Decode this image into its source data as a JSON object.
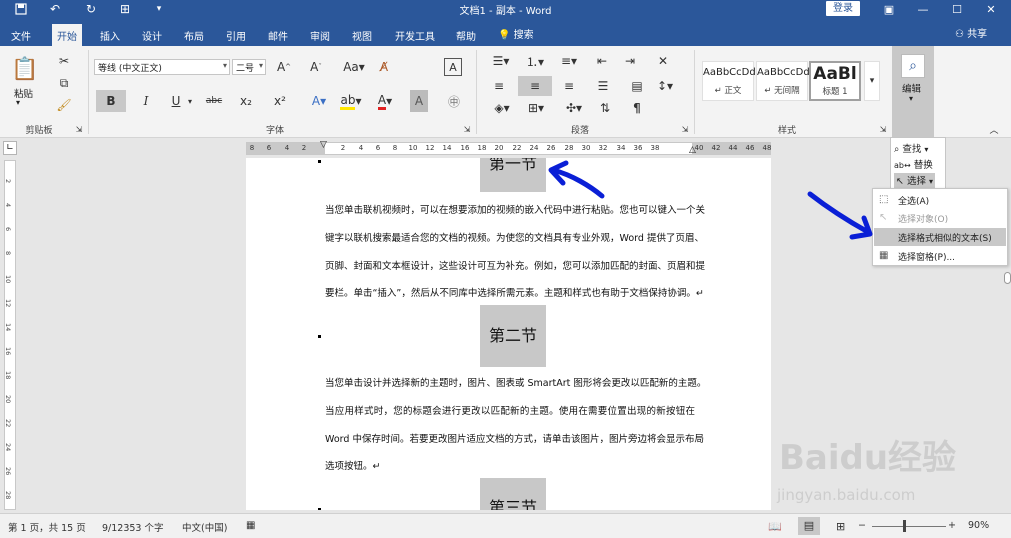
{
  "window": {
    "title": "文档1 - 副本  -  Word",
    "login_label": "登录"
  },
  "tabs": [
    "文件",
    "开始",
    "插入",
    "设计",
    "布局",
    "引用",
    "邮件",
    "审阅",
    "视图",
    "开发工具",
    "帮助"
  ],
  "active_tab": "开始",
  "tell_me": "搜索",
  "share": "共享",
  "ribbon": {
    "clipboard": {
      "paste_label": "粘贴",
      "group_label": "剪贴板"
    },
    "font": {
      "font_name": "等线 (中文正文)",
      "font_size": "二号",
      "group_label": "字体",
      "bold": "B",
      "italic": "I",
      "underline": "U",
      "strike": "abc",
      "subscript": "x₂",
      "superscript": "x²"
    },
    "paragraph": {
      "group_label": "段落"
    },
    "styles": {
      "group_label": "样式",
      "items": [
        {
          "preview": "AaBbCcDd",
          "name": "↵ 正文"
        },
        {
          "preview": "AaBbCcDd",
          "name": "↵ 无间隔"
        },
        {
          "preview": "AaBl",
          "name": "标题 1"
        }
      ]
    },
    "editing": {
      "label": "编辑"
    }
  },
  "ruler": {
    "left_ticks": [
      "8",
      "6",
      "4",
      "2"
    ],
    "ticks": [
      "2",
      "4",
      "6",
      "8",
      "10",
      "12",
      "14",
      "16",
      "18",
      "20",
      "22",
      "24",
      "26",
      "28",
      "30",
      "32",
      "34",
      "36",
      "38"
    ],
    "right_ticks": [
      "40",
      "42",
      "44",
      "46",
      "48"
    ],
    "vertical_ticks": [
      "2",
      "4",
      "6",
      "8",
      "10",
      "12",
      "14",
      "16",
      "18",
      "20",
      "22",
      "24",
      "26",
      "28"
    ]
  },
  "document": {
    "heading1": "第一节",
    "para1": [
      "当您单击联机视频时，可以在想要添加的视频的嵌入代码中进行粘贴。您也可以键入一个关",
      "键字以联机搜索最适合您的文档的视频。为使您的文档具有专业外观，Word 提供了页眉、",
      "页脚、封面和文本框设计，这些设计可互为补充。例如，您可以添加匹配的封面、页眉和提",
      "要栏。单击“插入”，然后从不同库中选择所需元素。主题和样式也有助于文档保持协调。↵"
    ],
    "heading2": "第二节",
    "para2": [
      "当您单击设计并选择新的主题时，图片、图表或 SmartArt 图形将会更改以匹配新的主题。",
      "当应用样式时，您的标题会进行更改以匹配新的主题。使用在需要位置出现的新按钮在",
      "Word 中保存时间。若要更改图片适应文档的方式，请单击该图片，图片旁边将会显示布局",
      "选项按钮。↵"
    ],
    "heading3": "第三节"
  },
  "editing_menu": {
    "find": "查找",
    "replace": "替换",
    "select": "选择"
  },
  "select_menu": [
    {
      "label": "全选(A)",
      "icon": "select-all-icon",
      "disabled": false,
      "highlighted": false
    },
    {
      "label": "选择对象(O)",
      "icon": "select-objects-icon",
      "disabled": true,
      "highlighted": false
    },
    {
      "label": "选择格式相似的文本(S)",
      "icon": "",
      "disabled": false,
      "highlighted": true
    },
    {
      "label": "选择窗格(P)...",
      "icon": "selection-pane-icon",
      "disabled": false,
      "highlighted": false
    }
  ],
  "statusbar": {
    "page": "第 1 页，共 15 页",
    "words": "9/12353 个字",
    "language": "中文(中国)",
    "zoom": "90%"
  },
  "watermark": {
    "brand": "Baidu经验",
    "url": "jingyan.baidu.com"
  },
  "colors": {
    "accent": "#2b579a",
    "annotation_arrow": "#0a1fd6",
    "heading_highlight": "#c8c8c8"
  }
}
